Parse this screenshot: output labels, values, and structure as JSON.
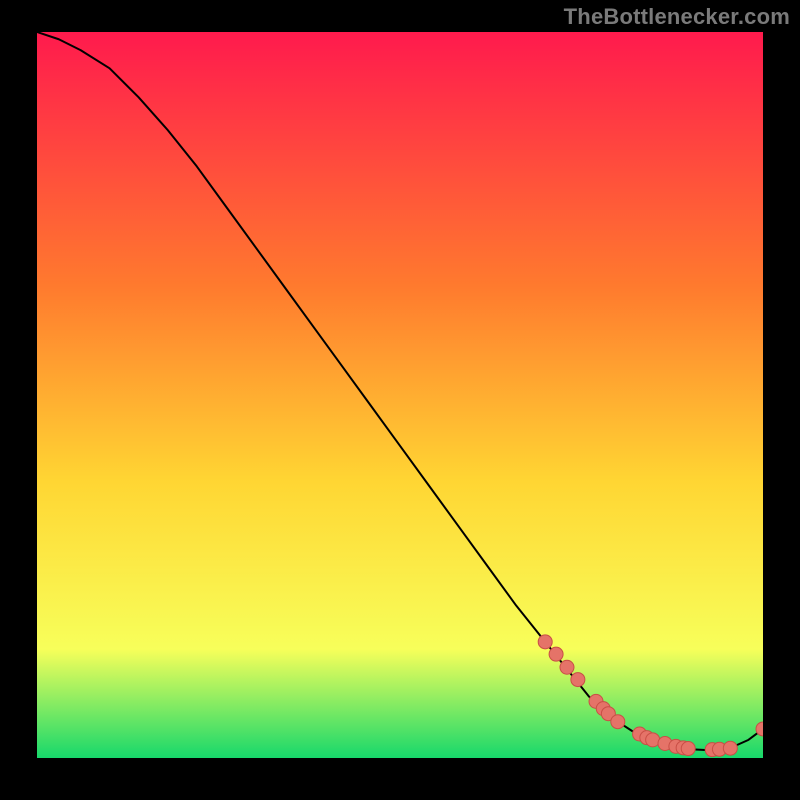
{
  "attribution": "TheBottlenecker.com",
  "colors": {
    "page_bg": "#000000",
    "text": "#7a7a7a",
    "curve": "#000000",
    "marker_fill": "#e57368",
    "marker_stroke": "#c94f46",
    "gradient_top": "#ff1a4d",
    "gradient_mid1": "#ff7a2e",
    "gradient_mid2": "#ffd633",
    "gradient_mid3": "#f7ff5a",
    "gradient_bottom": "#17d86b"
  },
  "chart_data": {
    "type": "line",
    "title": "",
    "xlabel": "",
    "ylabel": "",
    "xlim": [
      0,
      100
    ],
    "ylim": [
      0,
      100
    ],
    "grid": false,
    "legend": false,
    "series": [
      {
        "name": "bottleneck-curve",
        "x": [
          0,
          3,
          6,
          10,
          14,
          18,
          22,
          26,
          30,
          34,
          38,
          42,
          46,
          50,
          54,
          58,
          62,
          66,
          70,
          72,
          74,
          76,
          78,
          80,
          82,
          84,
          86,
          88,
          90,
          92,
          94,
          96,
          98,
          100
        ],
        "y": [
          100,
          99,
          97.5,
          95,
          91,
          86.5,
          81.5,
          76,
          70.5,
          65,
          59.5,
          54,
          48.5,
          43,
          37.5,
          32,
          26.5,
          21,
          16,
          13.5,
          11,
          8.5,
          6.5,
          5,
          3.7,
          2.7,
          2,
          1.5,
          1.2,
          1.1,
          1.2,
          1.6,
          2.5,
          4
        ]
      }
    ],
    "markers": {
      "name": "highlighted-points",
      "x": [
        70,
        71.5,
        73,
        74.5,
        77,
        78,
        78.7,
        80,
        83,
        84,
        84.8,
        86.5,
        88,
        89,
        89.7,
        93,
        94,
        95.5,
        100
      ],
      "y": [
        16,
        14.3,
        12.5,
        10.8,
        7.8,
        6.8,
        6.1,
        5,
        3.3,
        2.8,
        2.5,
        2,
        1.6,
        1.4,
        1.3,
        1.15,
        1.2,
        1.35,
        4
      ]
    }
  }
}
